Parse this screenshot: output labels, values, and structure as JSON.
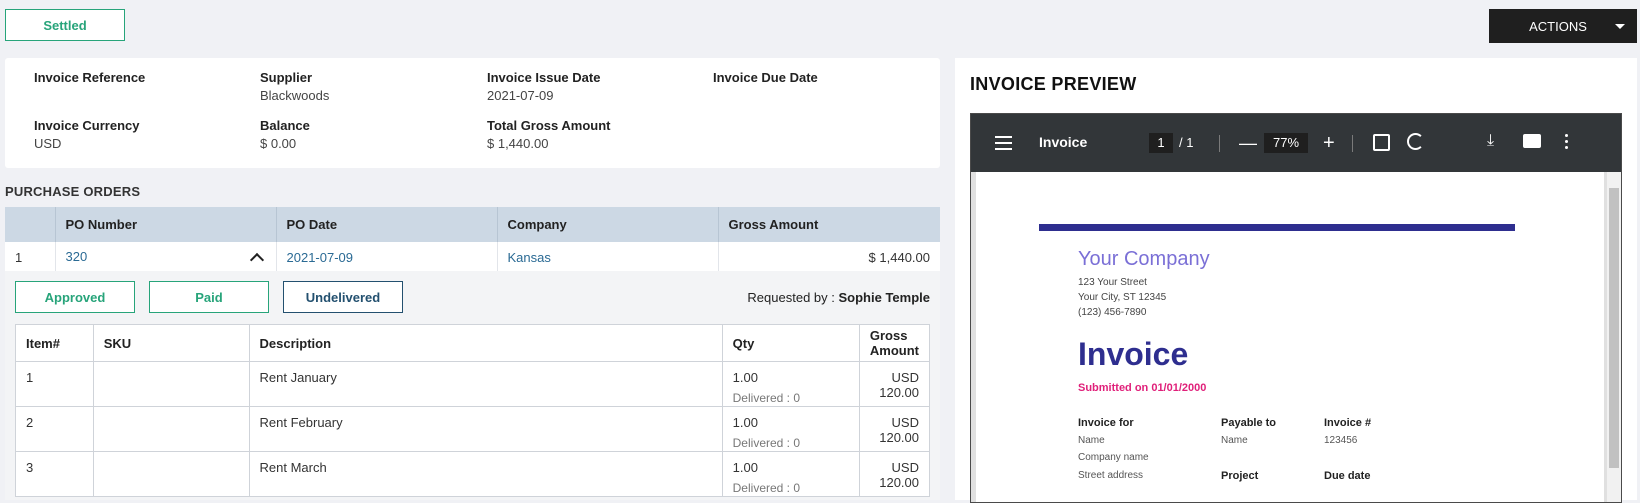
{
  "header": {
    "status": "Settled",
    "actions_label": "ACTIONS"
  },
  "summary": {
    "invoice_reference": {
      "label": "Invoice Reference",
      "value": ""
    },
    "supplier": {
      "label": "Supplier",
      "value": "Blackwoods"
    },
    "issue_date": {
      "label": "Invoice Issue Date",
      "value": "2021-07-09"
    },
    "due_date": {
      "label": "Invoice Due Date",
      "value": ""
    },
    "currency": {
      "label": "Invoice Currency",
      "value": "USD"
    },
    "balance": {
      "label": "Balance",
      "value": "$ 0.00"
    },
    "total_gross": {
      "label": "Total Gross Amount",
      "value": "$ 1,440.00"
    }
  },
  "purchase_orders": {
    "title": "PURCHASE ORDERS",
    "columns": [
      "",
      "PO Number",
      "PO Date",
      "Company",
      "Gross Amount"
    ],
    "rows": [
      {
        "index": "1",
        "po_number": "320",
        "po_date": "2021-07-09",
        "company": "Kansas",
        "gross": "$ 1,440.00"
      }
    ],
    "tags": {
      "approved": "Approved",
      "paid": "Paid",
      "delivery": "Undelivered"
    },
    "requested_label": "Requested by :",
    "requested_by": "Sophie Temple",
    "item_columns": [
      "Item#",
      "SKU",
      "Description",
      "Qty",
      "Gross Amount"
    ],
    "items": [
      {
        "num": "1",
        "sku": "",
        "desc": "Rent January",
        "qty": "1.00",
        "delivered": "Delivered : 0",
        "gross": "USD 120.00"
      },
      {
        "num": "2",
        "sku": "",
        "desc": "Rent February",
        "qty": "1.00",
        "delivered": "Delivered : 0",
        "gross": "USD 120.00"
      },
      {
        "num": "3",
        "sku": "",
        "desc": "Rent March",
        "qty": "1.00",
        "delivered": "Delivered : 0",
        "gross": "USD 120.00"
      }
    ]
  },
  "preview": {
    "title": "INVOICE PREVIEW",
    "viewer": {
      "doc_title": "Invoice",
      "page": "1",
      "page_total": "/ 1",
      "zoom": "77%"
    },
    "document": {
      "company": "Your Company",
      "address1": "123 Your Street",
      "address2": "Your City, ST 12345",
      "phone": "(123) 456-7890",
      "heading": "Invoice",
      "submitted": "Submitted on 01/01/2000",
      "invoice_for": "Invoice for",
      "name": "Name",
      "company_name": "Company name",
      "street": "Street address",
      "payable_to": "Payable to",
      "payable_name": "Name",
      "project": "Project",
      "invoice_no_label": "Invoice #",
      "invoice_no": "123456",
      "due_date": "Due date"
    }
  }
}
